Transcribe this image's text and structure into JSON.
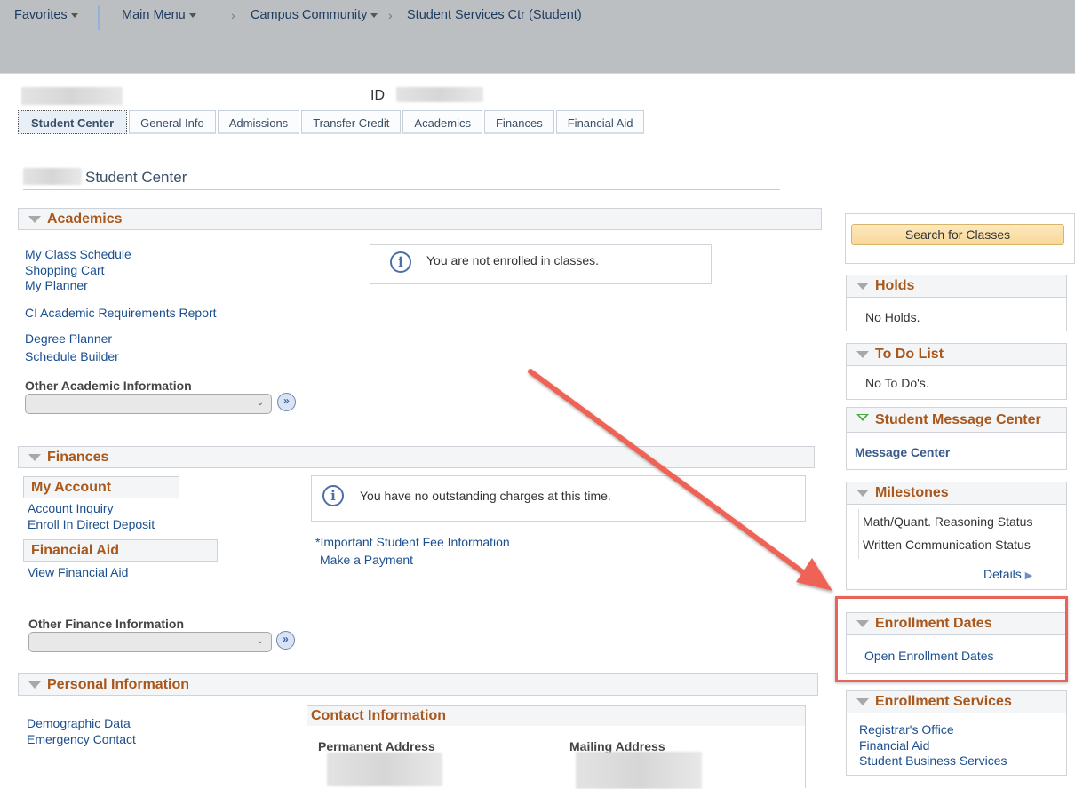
{
  "topnav": {
    "favorites": "Favorites",
    "main_menu": "Main Menu",
    "breadcrumbs": [
      "Campus Community",
      "Student Services Ctr (Student)"
    ],
    "crumb_separator": "›"
  },
  "header": {
    "id_label": "ID",
    "page_title": "Student Center"
  },
  "tabs": [
    {
      "label": "Student Center",
      "active": true
    },
    {
      "label": "General Info",
      "active": false
    },
    {
      "label": "Admissions",
      "active": false
    },
    {
      "label": "Transfer Credit",
      "active": false
    },
    {
      "label": "Academics",
      "active": false
    },
    {
      "label": "Finances",
      "active": false
    },
    {
      "label": "Financial Aid",
      "active": false
    }
  ],
  "academics": {
    "title": "Academics",
    "links": [
      "My Class Schedule",
      "Shopping Cart",
      "My Planner",
      "CI Academic Requirements Report",
      "Degree Planner",
      "Schedule Builder"
    ],
    "info_message": "You are not enrolled in classes.",
    "other_label": "Other Academic Information",
    "other_selected": ""
  },
  "finances": {
    "title": "Finances",
    "my_account": {
      "title": "My Account",
      "links": [
        "Account Inquiry",
        "Enroll In Direct Deposit"
      ]
    },
    "financial_aid": {
      "title": "Financial Aid",
      "links": [
        "View Financial Aid"
      ]
    },
    "info_message": "You have no outstanding charges at this time.",
    "extra_links": [
      "*Important Student Fee Information",
      "Make a Payment"
    ],
    "other_label": "Other Finance Information",
    "other_selected": ""
  },
  "personal": {
    "title": "Personal Information",
    "links": [
      "Demographic Data",
      "Emergency Contact"
    ],
    "contact": {
      "title": "Contact Information",
      "permanent_label": "Permanent Address",
      "mailing_label": "Mailing Address"
    }
  },
  "sidebar": {
    "search_button": "Search for Classes",
    "holds": {
      "title": "Holds",
      "text": "No Holds."
    },
    "todo": {
      "title": "To Do List",
      "text": "No To Do's."
    },
    "messages": {
      "title": "Student Message Center",
      "link": "Message Center"
    },
    "milestones": {
      "title": "Milestones",
      "items": [
        "Math/Quant. Reasoning Status",
        "Written Communication Status"
      ],
      "details": "Details"
    },
    "enrollment_dates": {
      "title": "Enrollment Dates",
      "link": "Open Enrollment Dates"
    },
    "enrollment_services": {
      "title": "Enrollment Services",
      "links": [
        "Registrar's Office",
        "Financial Aid",
        "Student Business Services"
      ]
    }
  },
  "annotation": {
    "color": "#e8645a",
    "target": "Enrollment Dates"
  }
}
